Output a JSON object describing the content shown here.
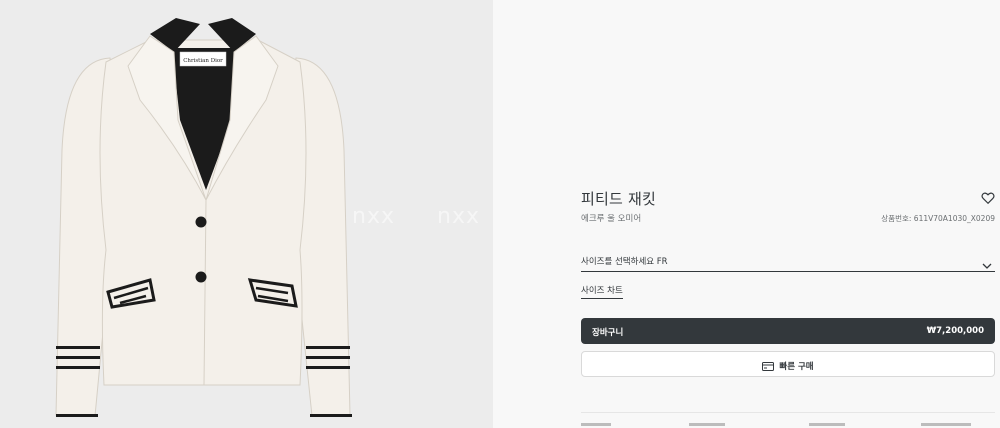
{
  "product": {
    "title": "피티드 재킷",
    "subtitle": "에크루 울 오미어",
    "ref": "상품번호: 611V70A1030_X0209",
    "brand_label": "Christian Dior"
  },
  "size_select": {
    "label": "사이즈를 선택하세요 FR"
  },
  "size_chart": {
    "label": "사이즈 차트"
  },
  "cart": {
    "label": "장바구니",
    "price": "₩7,200,000"
  },
  "quick_buy": {
    "label": "빠른 구매"
  },
  "watermark": [
    "nxx",
    "nxx",
    "nxx"
  ],
  "colors": {
    "button_dark": "#33383c",
    "background": "#f8f8f8",
    "image_bg": "#ececec",
    "jacket": "#f4f0ea"
  }
}
